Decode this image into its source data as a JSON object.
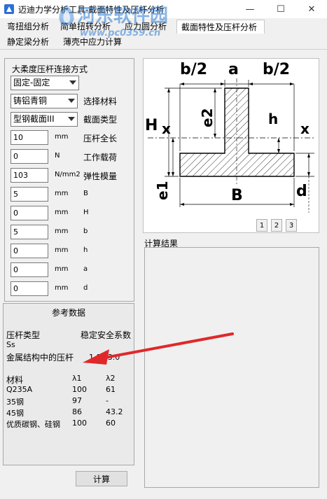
{
  "window": {
    "title": "迈迪力学分析工具-截面特性及压杆分析",
    "minimize": "—",
    "maximize": "☐",
    "close": "✕"
  },
  "watermark": {
    "text": "河东软件园",
    "url": "www.pc0359.cn"
  },
  "tabs": {
    "row1": [
      "弯扭组分析",
      "简单扭转分析",
      "应力圆分析",
      "截面特性及压杆分析"
    ],
    "row2": [
      "静定梁分析",
      "薄壳中应力计算"
    ],
    "active": "截面特性及压杆分析"
  },
  "form": {
    "connection_label": "大柔度压杆连接方式",
    "connection_value": "固定-固定",
    "material_value": "铸铝青铜",
    "material_label": "选择材料",
    "section_value": "型钢截面III",
    "section_label": "截面类型",
    "params": [
      {
        "value": "10",
        "unit": "mm",
        "name": "压杆全长"
      },
      {
        "value": "0",
        "unit": "N",
        "name": "工作载荷"
      },
      {
        "value": "103",
        "unit": "N/mm2",
        "name": "弹性模量"
      },
      {
        "value": "5",
        "unit": "mm",
        "name": "B"
      },
      {
        "value": "0",
        "unit": "mm",
        "name": "H"
      },
      {
        "value": "5",
        "unit": "mm",
        "name": "b"
      },
      {
        "value": "0",
        "unit": "mm",
        "name": "h"
      },
      {
        "value": "0",
        "unit": "mm",
        "name": "a"
      },
      {
        "value": "0",
        "unit": "mm",
        "name": "d"
      }
    ]
  },
  "reference": {
    "title": "参考数据",
    "col1_header": "压杆类型",
    "col2_header": "稳定安全系数",
    "symbol": "Ss",
    "row1_type": "金属结构中的压杆",
    "row1_value": "1.8~3.0",
    "table_headers": [
      "材料",
      "λ1",
      "λ2"
    ],
    "table_rows": [
      [
        "Q235A",
        "100",
        "61"
      ],
      [
        "35钢",
        "97",
        "-"
      ],
      [
        "45钢",
        "86",
        "43.2"
      ],
      [
        "优质碳钢、硅钢",
        "100",
        "60"
      ]
    ]
  },
  "diagram": {
    "labels": {
      "b2_left": "b/2",
      "a": "a",
      "b2_right": "b/2",
      "H": "H",
      "x_left": "x",
      "e2": "e2",
      "h": "h",
      "x_right": "x",
      "e1": "e1",
      "B": "B",
      "d": "d"
    },
    "pages": [
      "1",
      "2",
      "3"
    ]
  },
  "result": {
    "label": "计算结果"
  },
  "actions": {
    "calculate": "计算"
  },
  "colors": {
    "arrow": "#e0282a",
    "watermark": "#2878d2"
  }
}
